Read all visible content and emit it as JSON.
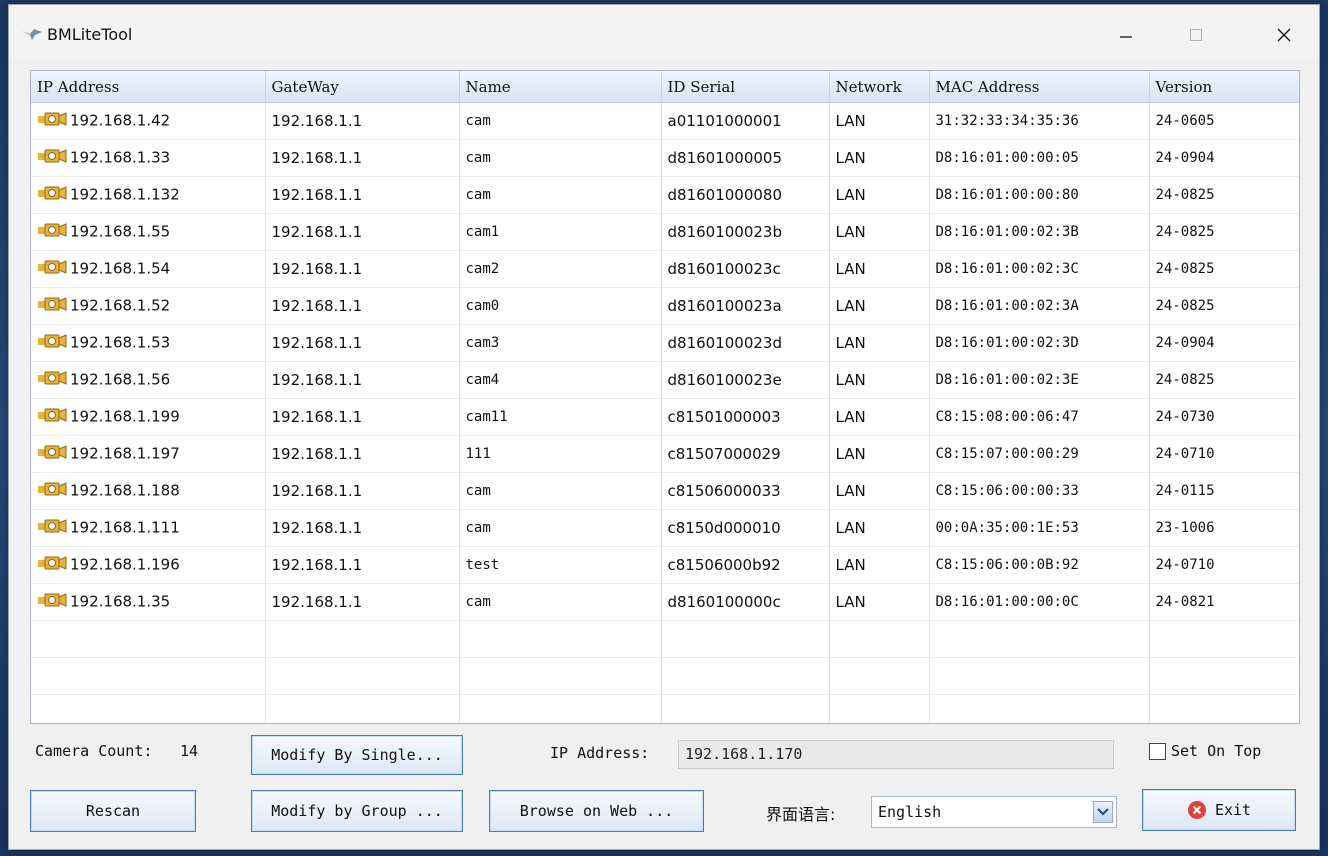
{
  "window": {
    "title": "BMLiteTool"
  },
  "table": {
    "columns": [
      "IP Address",
      "GateWay",
      "Name",
      "ID Serial",
      "Network",
      "MAC Address",
      "Version"
    ],
    "rows": [
      [
        "192.168.1.42",
        "192.168.1.1",
        "cam",
        "a01101000001",
        "LAN",
        "31:32:33:34:35:36",
        "24-0605"
      ],
      [
        "192.168.1.33",
        "192.168.1.1",
        "cam",
        "d81601000005",
        "LAN",
        "D8:16:01:00:00:05",
        "24-0904"
      ],
      [
        "192.168.1.132",
        "192.168.1.1",
        "cam",
        "d81601000080",
        "LAN",
        "D8:16:01:00:00:80",
        "24-0825"
      ],
      [
        "192.168.1.55",
        "192.168.1.1",
        "cam1",
        "d8160100023b",
        "LAN",
        "D8:16:01:00:02:3B",
        "24-0825"
      ],
      [
        "192.168.1.54",
        "192.168.1.1",
        "cam2",
        "d8160100023c",
        "LAN",
        "D8:16:01:00:02:3C",
        "24-0825"
      ],
      [
        "192.168.1.52",
        "192.168.1.1",
        "cam0",
        "d8160100023a",
        "LAN",
        "D8:16:01:00:02:3A",
        "24-0825"
      ],
      [
        "192.168.1.53",
        "192.168.1.1",
        "cam3",
        "d8160100023d",
        "LAN",
        "D8:16:01:00:02:3D",
        "24-0904"
      ],
      [
        "192.168.1.56",
        "192.168.1.1",
        "cam4",
        "d8160100023e",
        "LAN",
        "D8:16:01:00:02:3E",
        "24-0825"
      ],
      [
        "192.168.1.199",
        "192.168.1.1",
        "cam11",
        "c81501000003",
        "LAN",
        "C8:15:08:00:06:47",
        "24-0730"
      ],
      [
        "192.168.1.197",
        "192.168.1.1",
        "111",
        "c81507000029",
        "LAN",
        "C8:15:07:00:00:29",
        "24-0710"
      ],
      [
        "192.168.1.188",
        "192.168.1.1",
        "cam",
        "c81506000033",
        "LAN",
        "C8:15:06:00:00:33",
        "24-0115"
      ],
      [
        "192.168.1.111",
        "192.168.1.1",
        "cam",
        "c8150d000010",
        "LAN",
        "00:0A:35:00:1E:53",
        "23-1006"
      ],
      [
        "192.168.1.196",
        "192.168.1.1",
        "test",
        "c81506000b92",
        "LAN",
        "C8:15:06:00:0B:92",
        "24-0710"
      ],
      [
        "192.168.1.35",
        "192.168.1.1",
        "cam",
        "d8160100000c",
        "LAN",
        "D8:16:01:00:00:0C",
        "24-0821"
      ]
    ],
    "empty_rows": 3
  },
  "footer": {
    "camera_count_label": "Camera Count:",
    "camera_count_value": "14",
    "modify_single_label": "Modify By Single...",
    "modify_group_label": "Modify by Group ...",
    "rescan_label": "Rescan",
    "browse_web_label": "Browse on Web ...",
    "ip_address_label": "IP Address:",
    "ip_address_value": "192.168.1.170",
    "set_on_top_label": "Set On Top",
    "set_on_top_checked": false,
    "language_label": "界面语言:",
    "language_value": "English",
    "exit_label": "Exit"
  },
  "icons": {
    "app": "bird-icon",
    "camera_row": "camera-icon",
    "exit": "close-circle-icon",
    "dropdown": "chevron-down-icon"
  },
  "colors": {
    "header_bg": "#d7e4f4",
    "button_border": "#4a7ab8",
    "exit_icon": "#e0413a",
    "camera_icon": "#e8b33a"
  }
}
